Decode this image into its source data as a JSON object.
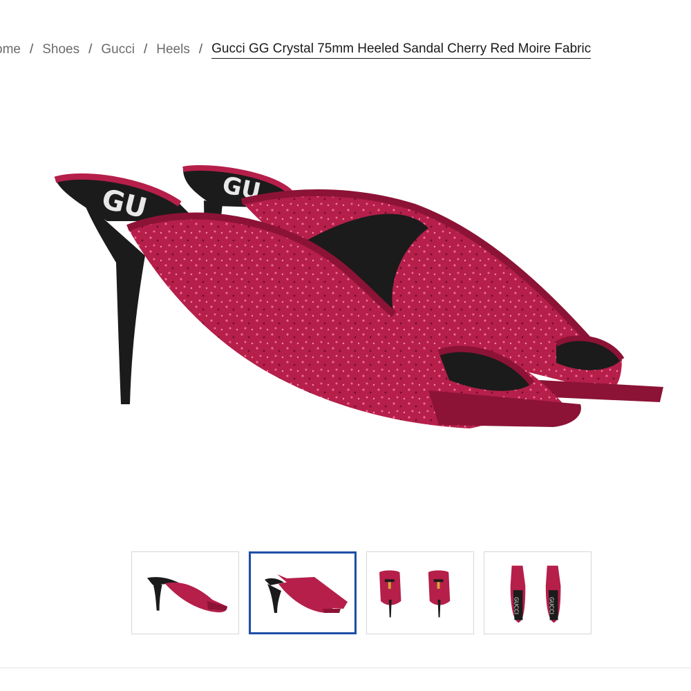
{
  "breadcrumb": {
    "items": [
      "ome",
      "Shoes",
      "Gucci",
      "Heels"
    ],
    "current": "Gucci GG Crystal 75mm Heeled Sandal Cherry Red Moire Fabric",
    "separator": "/"
  },
  "main_image": {
    "insole_logo_text": "GU"
  },
  "thumbnails": {
    "count": 4,
    "selected_index": 1,
    "logo_text": "GUCCI"
  },
  "colors": {
    "shoe_red": "#b51f4a",
    "shoe_red_dark": "#8c1336",
    "heel_black": "#1b1b1b",
    "crystal_pink": "#f06a98",
    "selected_border": "#1f4fa8"
  }
}
